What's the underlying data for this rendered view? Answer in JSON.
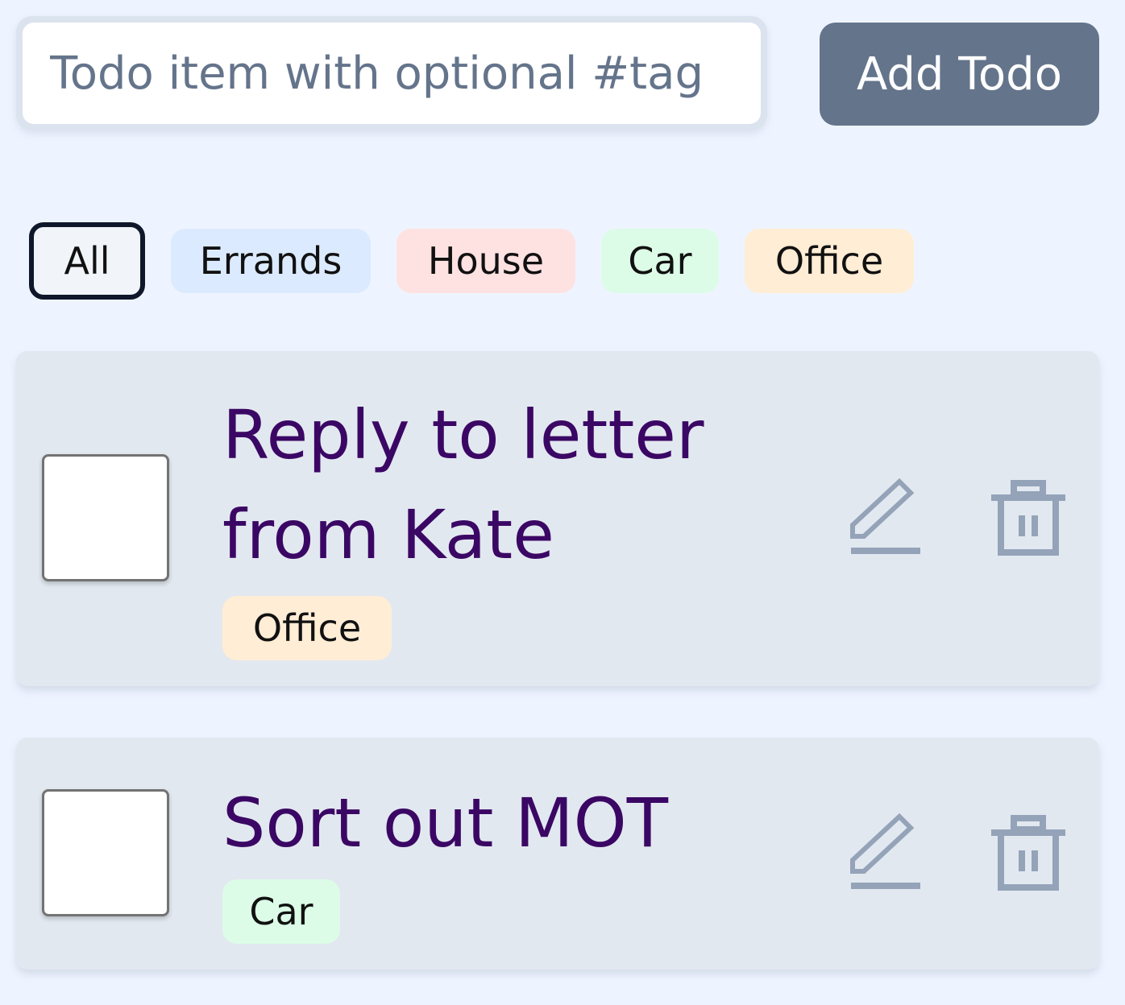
{
  "new_todo": {
    "placeholder": "Todo item with optional #tag",
    "value": ""
  },
  "add_button": {
    "label": "Add Todo"
  },
  "filters": [
    {
      "label": "All",
      "active": true,
      "color": "#f1f5f9"
    },
    {
      "label": "Errands",
      "active": false,
      "color": "#dbeafe"
    },
    {
      "label": "House",
      "active": false,
      "color": "#fee2e2"
    },
    {
      "label": "Car",
      "active": false,
      "color": "#dcfce7"
    },
    {
      "label": "Office",
      "active": false,
      "color": "#ffedd5"
    }
  ],
  "todos": [
    {
      "text": "Reply to letter from Kate",
      "tag": "Office",
      "tag_color": "#ffedd5",
      "done": false,
      "edit_icon": "pencil-icon",
      "delete_icon": "trash-icon"
    },
    {
      "text": "Sort out MOT",
      "tag": "Car",
      "tag_color": "#dcfce7",
      "done": false,
      "edit_icon": "pencil-icon",
      "delete_icon": "trash-icon"
    }
  ],
  "colors": {
    "background": "#eef4ff",
    "button": "#64748b",
    "card": "#e2e8f0",
    "todo_text": "#3b0764",
    "icon": "#94a3b8",
    "active_filter_border": "#0f172a"
  }
}
